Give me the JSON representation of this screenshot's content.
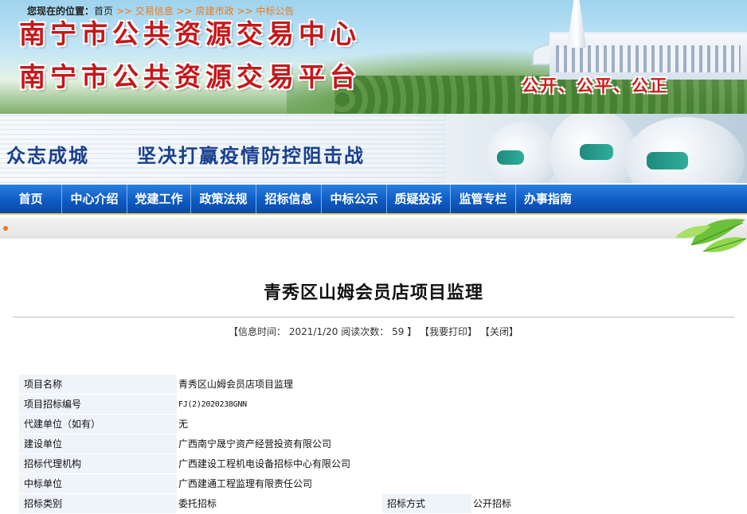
{
  "banner": {
    "title_line1": "南宁市公共资源交易中心",
    "title_line2": "南宁市公共资源交易平台",
    "slogan": "公开、公平、公正"
  },
  "band": {
    "text_a": "众志成城",
    "text_b": "坚决打赢疫情防控阻击战"
  },
  "nav": {
    "items": [
      "首页",
      "中心介绍",
      "党建工作",
      "政策法规",
      "招标信息",
      "中标公示",
      "质疑投诉",
      "监管专栏",
      "办事指南"
    ]
  },
  "breadcrumb": {
    "lead": "您现在的位置：",
    "home": "首页",
    "sep": ">>",
    "items": [
      "交易信息",
      "房建市政",
      "中标公告"
    ]
  },
  "article": {
    "title": "青秀区山姆会员店项目监理",
    "info": {
      "open": "【",
      "close": "】",
      "time_label": "信息时间：",
      "time_value": "2021/1/20",
      "views_label": "阅读次数：",
      "views_value": "59",
      "print": "我要打印",
      "close_label": "关闭"
    }
  },
  "detail": {
    "rows": [
      {
        "label": "项目名称",
        "value": "青秀区山姆会员店项目监理"
      },
      {
        "label": "项目招标编号",
        "value": "FJ(2)2020238GNN"
      },
      {
        "label": "代建单位（如有）",
        "value": "无"
      },
      {
        "label": "建设单位",
        "value": "广西南宁晟宁资产经营投资有限公司"
      },
      {
        "label": "招标代理机构",
        "value": "广西建设工程机电设备招标中心有限公司"
      },
      {
        "label": "中标单位",
        "value": "广西建通工程监理有限责任公司"
      }
    ],
    "split_row": {
      "label": "招标类别",
      "value": "委托招标",
      "label2": "招标方式",
      "value2": "公开招标"
    }
  },
  "colors": {
    "nav_blue": "#0e5bc4",
    "banner_red": "#c4181b",
    "band_blue": "#1a3f8f",
    "breadcrumb_orange": "#ef7a1b",
    "label_bg": "#eef4f9"
  }
}
